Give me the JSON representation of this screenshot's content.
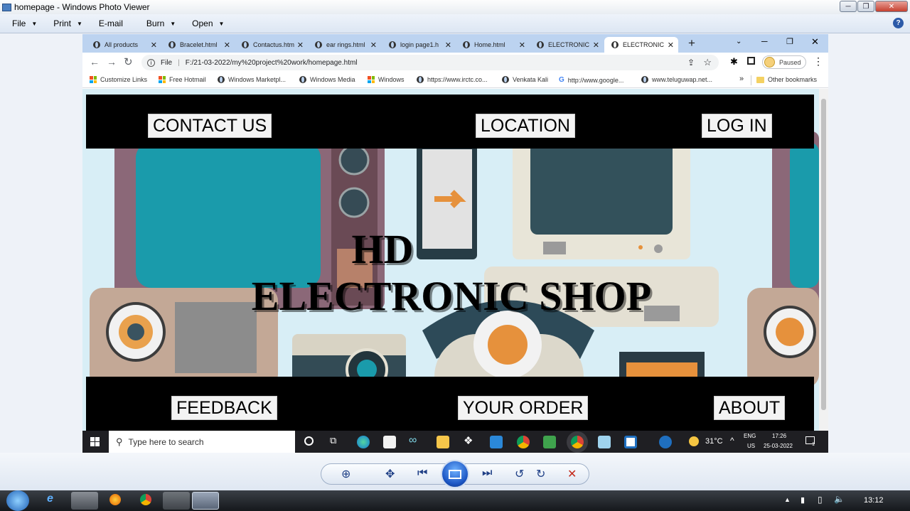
{
  "viewer": {
    "title": "homepage - Windows Photo Viewer",
    "menu": [
      "File",
      "Print",
      "E-mail",
      "Burn",
      "Open"
    ],
    "help": "?"
  },
  "browser": {
    "tabs": [
      {
        "label": "All products",
        "active": false
      },
      {
        "label": "Bracelet.html",
        "active": false
      },
      {
        "label": "Contactus.htm",
        "active": false
      },
      {
        "label": "ear rings.html",
        "active": false
      },
      {
        "label": "login page1.h",
        "active": false
      },
      {
        "label": "Home.html",
        "active": false
      },
      {
        "label": "ELECTRONIC",
        "active": false
      },
      {
        "label": "ELECTRONIC",
        "active": true
      }
    ],
    "new_tab": "+",
    "url_scheme": "File",
    "url": "F:/21-03-2022/my%20project%20work/homepage.html",
    "profile_status": "Paused",
    "bookmarks": [
      "Customize Links",
      "Free Hotmail",
      "Windows Marketpl...",
      "Windows Media",
      "Windows",
      "https://www.irctc.co...",
      "Venkata Kali",
      "http://www.google...",
      "www.teluguwap.net..."
    ],
    "bookmarks_more": "»",
    "other_bookmarks": "Other bookmarks"
  },
  "site": {
    "top_nav": [
      "CONTACT US",
      "LOCATION",
      "LOG IN"
    ],
    "hero_line1": "HD",
    "hero_line2": "ELECTRONIC SHOP",
    "bottom_nav": [
      "FEEDBACK",
      "YOUR ORDER",
      "ABOUT"
    ]
  },
  "win10_taskbar": {
    "search_placeholder": "Type here to search",
    "weather": "31°C",
    "lang": "ENG",
    "region": "US",
    "time": "17:26",
    "date": "25-03-2022",
    "notification_count": "1"
  },
  "win7_taskbar": {
    "time": "13:12"
  },
  "colors": {
    "tabstrip": "#bcd3f0",
    "navbar": "#000000",
    "page_bg": "#d8eef6",
    "close_red": "#c42b1c"
  }
}
